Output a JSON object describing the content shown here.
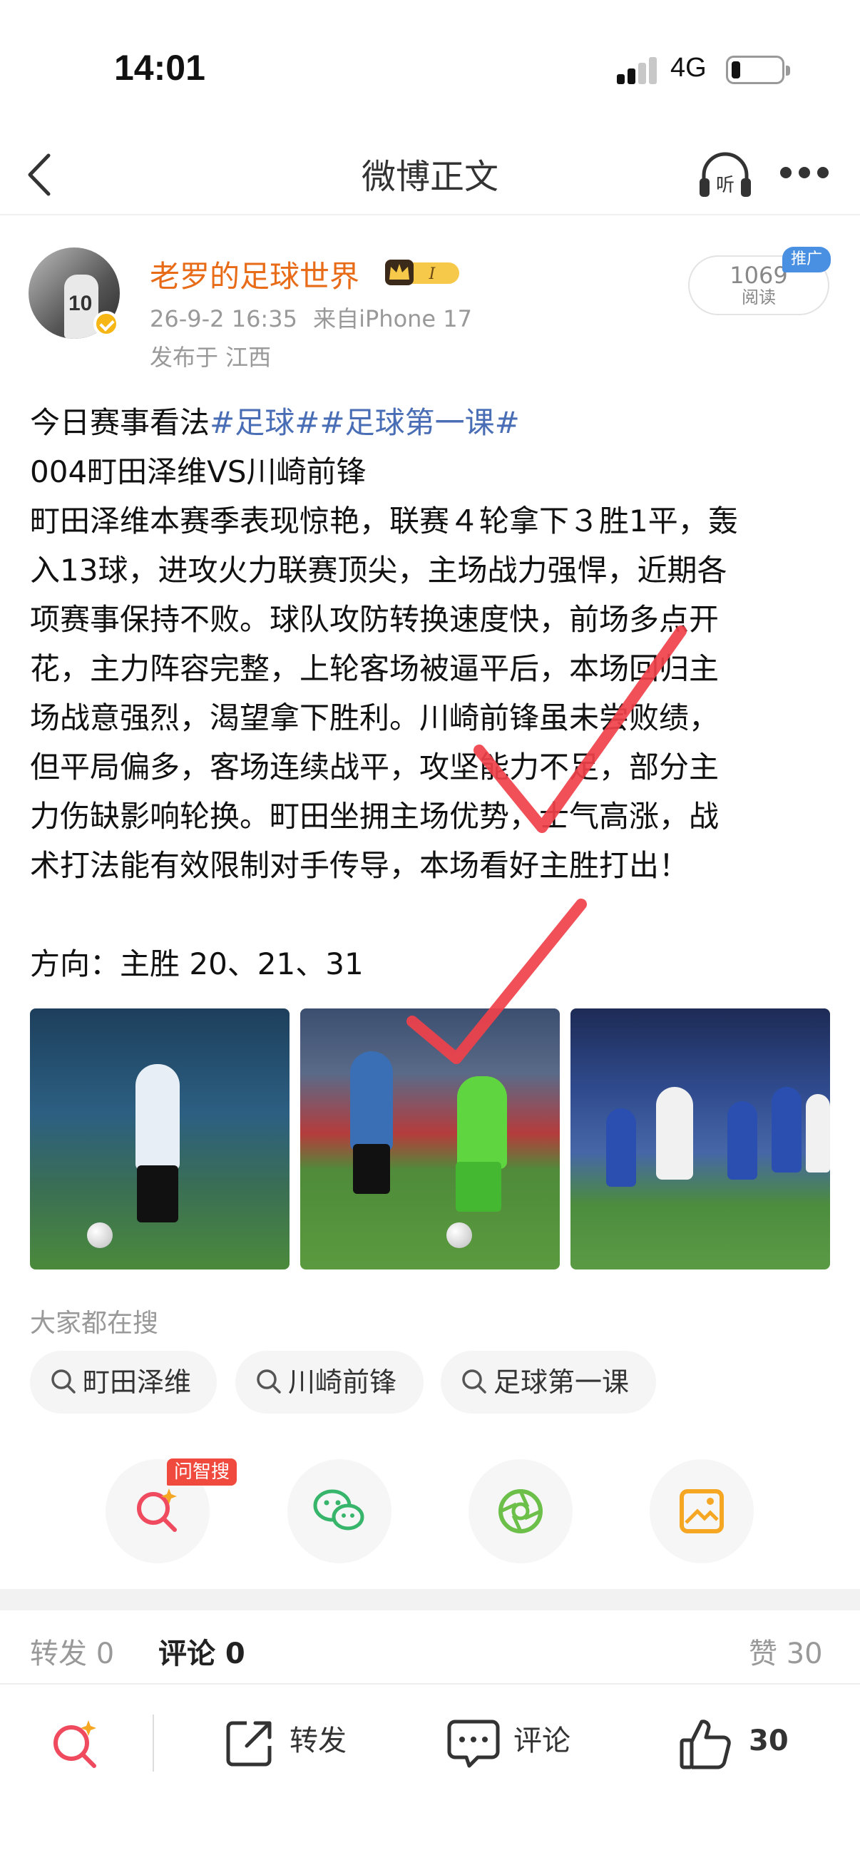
{
  "status_bar": {
    "time": "14:01",
    "network": "4G"
  },
  "nav": {
    "title": "微博正文",
    "listen_icon": "headphones-icon",
    "more_icon": "more-icon"
  },
  "post": {
    "author": "老罗的足球世界",
    "badge_text": "I",
    "timestamp": "26-9-2 16:35",
    "source": "来自iPhone 17",
    "location": "发布于 江西",
    "read_count": "1069",
    "read_label": "阅读",
    "promo_tag": "推广",
    "body": {
      "line1_text": "今日赛事看法",
      "line1_tag1": "#足球#",
      "line1_tag2": "#足球第一课#",
      "lines": [
        "004町田泽维VS川崎前锋",
        "町田泽维本赛季表现惊艳，联赛４轮拿下３胜1平，轰",
        "入13球，进攻火力联赛顶尖，主场战力强悍，近期各",
        "项赛事保持不败。球队攻防转换速度快，前场多点开",
        "花，主力阵容完整，上轮客场被逼平后，本场回归主",
        "场战意强烈，渴望拿下胜利。川崎前锋虽未尝败绩，",
        "但平局偏多，客场连续战平，攻坚能力不足，部分主",
        "力伤缺影响轮换。町田坐拥主场优势，士气高涨，战",
        "术打法能有效限制对手传导，本场看好主胜打出！"
      ],
      "direction": "方向：主胜   20、21、31"
    }
  },
  "trending": {
    "label": "大家都在搜",
    "chips": [
      "町田泽维",
      "川崎前锋",
      "足球第一课"
    ]
  },
  "share": {
    "zhisou_tag": "问智搜"
  },
  "tabs": {
    "repost": "转发 0",
    "comment": "评论 0",
    "like": "赞 30"
  },
  "bottom_bar": {
    "repost": "转发",
    "comment": "评论",
    "like_count": "30"
  },
  "colors": {
    "accent_orange": "#e86b18",
    "hashtag_blue": "#4a6eb5",
    "check_red": "#f0414a"
  }
}
